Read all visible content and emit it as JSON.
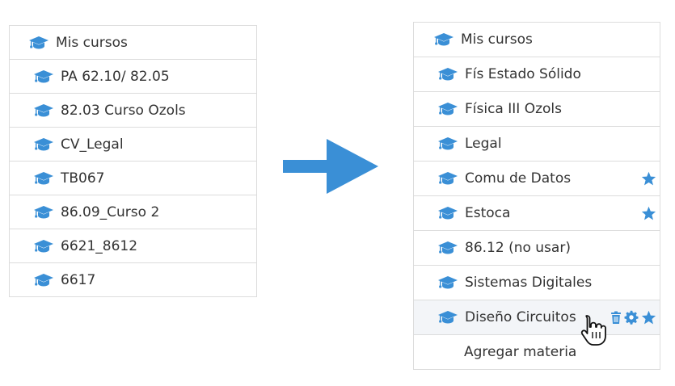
{
  "accent_color": "#3a8fd6",
  "left_panel": {
    "header": {
      "icon": "graduation-cap-icon",
      "label": "Mis cursos"
    },
    "items": [
      {
        "icon": "graduation-cap-icon",
        "label": "PA 62.10/ 82.05"
      },
      {
        "icon": "graduation-cap-icon",
        "label": "82.03 Curso Ozols"
      },
      {
        "icon": "graduation-cap-icon",
        "label": "CV_Legal"
      },
      {
        "icon": "graduation-cap-icon",
        "label": "TB067"
      },
      {
        "icon": "graduation-cap-icon",
        "label": "86.09_Curso 2"
      },
      {
        "icon": "graduation-cap-icon",
        "label": "6621_8612"
      },
      {
        "icon": "graduation-cap-icon",
        "label": "6617"
      }
    ]
  },
  "transition_arrow": {
    "icon": "right-arrow-icon"
  },
  "right_panel": {
    "header": {
      "icon": "graduation-cap-icon",
      "label": "Mis cursos"
    },
    "items": [
      {
        "icon": "graduation-cap-icon",
        "label": "Fís Estado Sólido",
        "favorite": false
      },
      {
        "icon": "graduation-cap-icon",
        "label": "Física III Ozols",
        "favorite": false
      },
      {
        "icon": "graduation-cap-icon",
        "label": "Legal",
        "favorite": false
      },
      {
        "icon": "graduation-cap-icon",
        "label": "Comu de Datos",
        "favorite": true
      },
      {
        "icon": "graduation-cap-icon",
        "label": "Estoca",
        "favorite": true
      },
      {
        "icon": "graduation-cap-icon",
        "label": "86.12 (no usar)",
        "favorite": false
      },
      {
        "icon": "graduation-cap-icon",
        "label": "Sistemas Digitales",
        "favorite": false
      },
      {
        "icon": "graduation-cap-icon",
        "label": "Diseño Circuitos",
        "favorite": true,
        "hovered": true,
        "actions": [
          "trash-icon",
          "gear-icon",
          "star-icon"
        ]
      }
    ],
    "add_item": {
      "label": "Agregar materia"
    }
  },
  "cursor": {
    "icon": "hand-pointer-icon"
  }
}
